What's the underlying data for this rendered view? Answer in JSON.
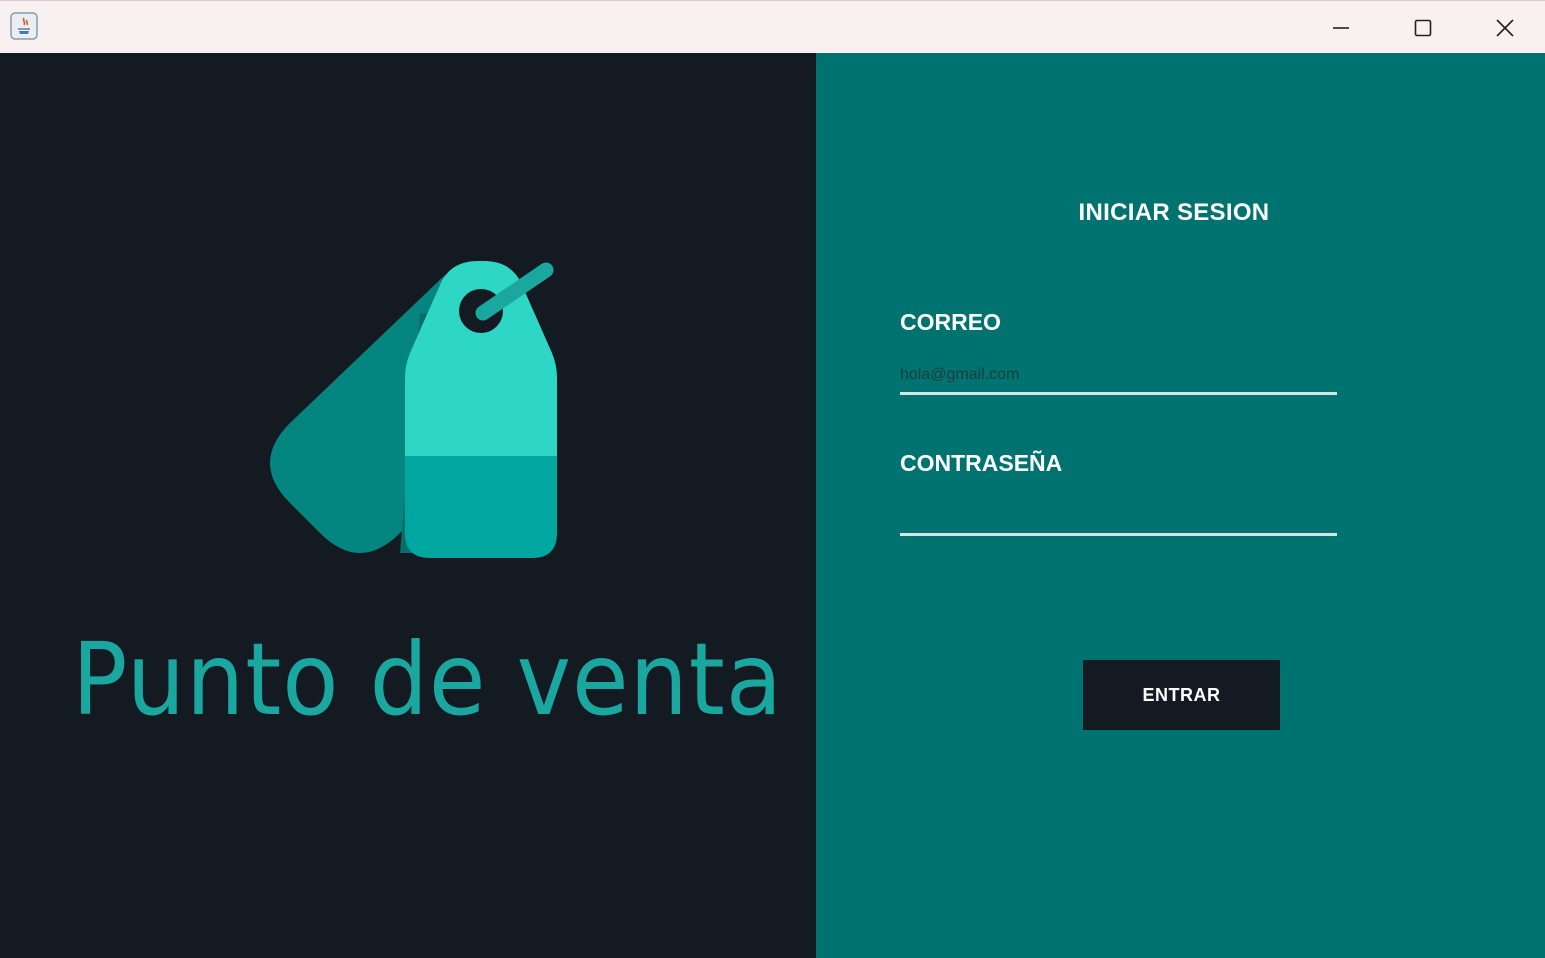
{
  "window": {
    "app_icon": "java-app-icon",
    "controls": {
      "minimize": "minimize-icon",
      "maximize": "maximize-icon",
      "close": "close-icon"
    }
  },
  "brand": {
    "title": "Punto de venta",
    "logo": "price-tag-icon",
    "colors": {
      "background": "#131a22",
      "text": "#1aa7a0",
      "tag_front_light": "#2ed6c6",
      "tag_front_dark": "#00a6a0",
      "tag_back": "#05857f"
    }
  },
  "login": {
    "title": "INICIAR SESION",
    "email_label": "CORREO",
    "email_placeholder": "hola@gmail.com",
    "email_value": "",
    "password_label": "CONTRASEÑA",
    "password_value": "",
    "submit_label": "ENTRAR",
    "colors": {
      "panel": "#007370",
      "button": "#131a22"
    }
  }
}
